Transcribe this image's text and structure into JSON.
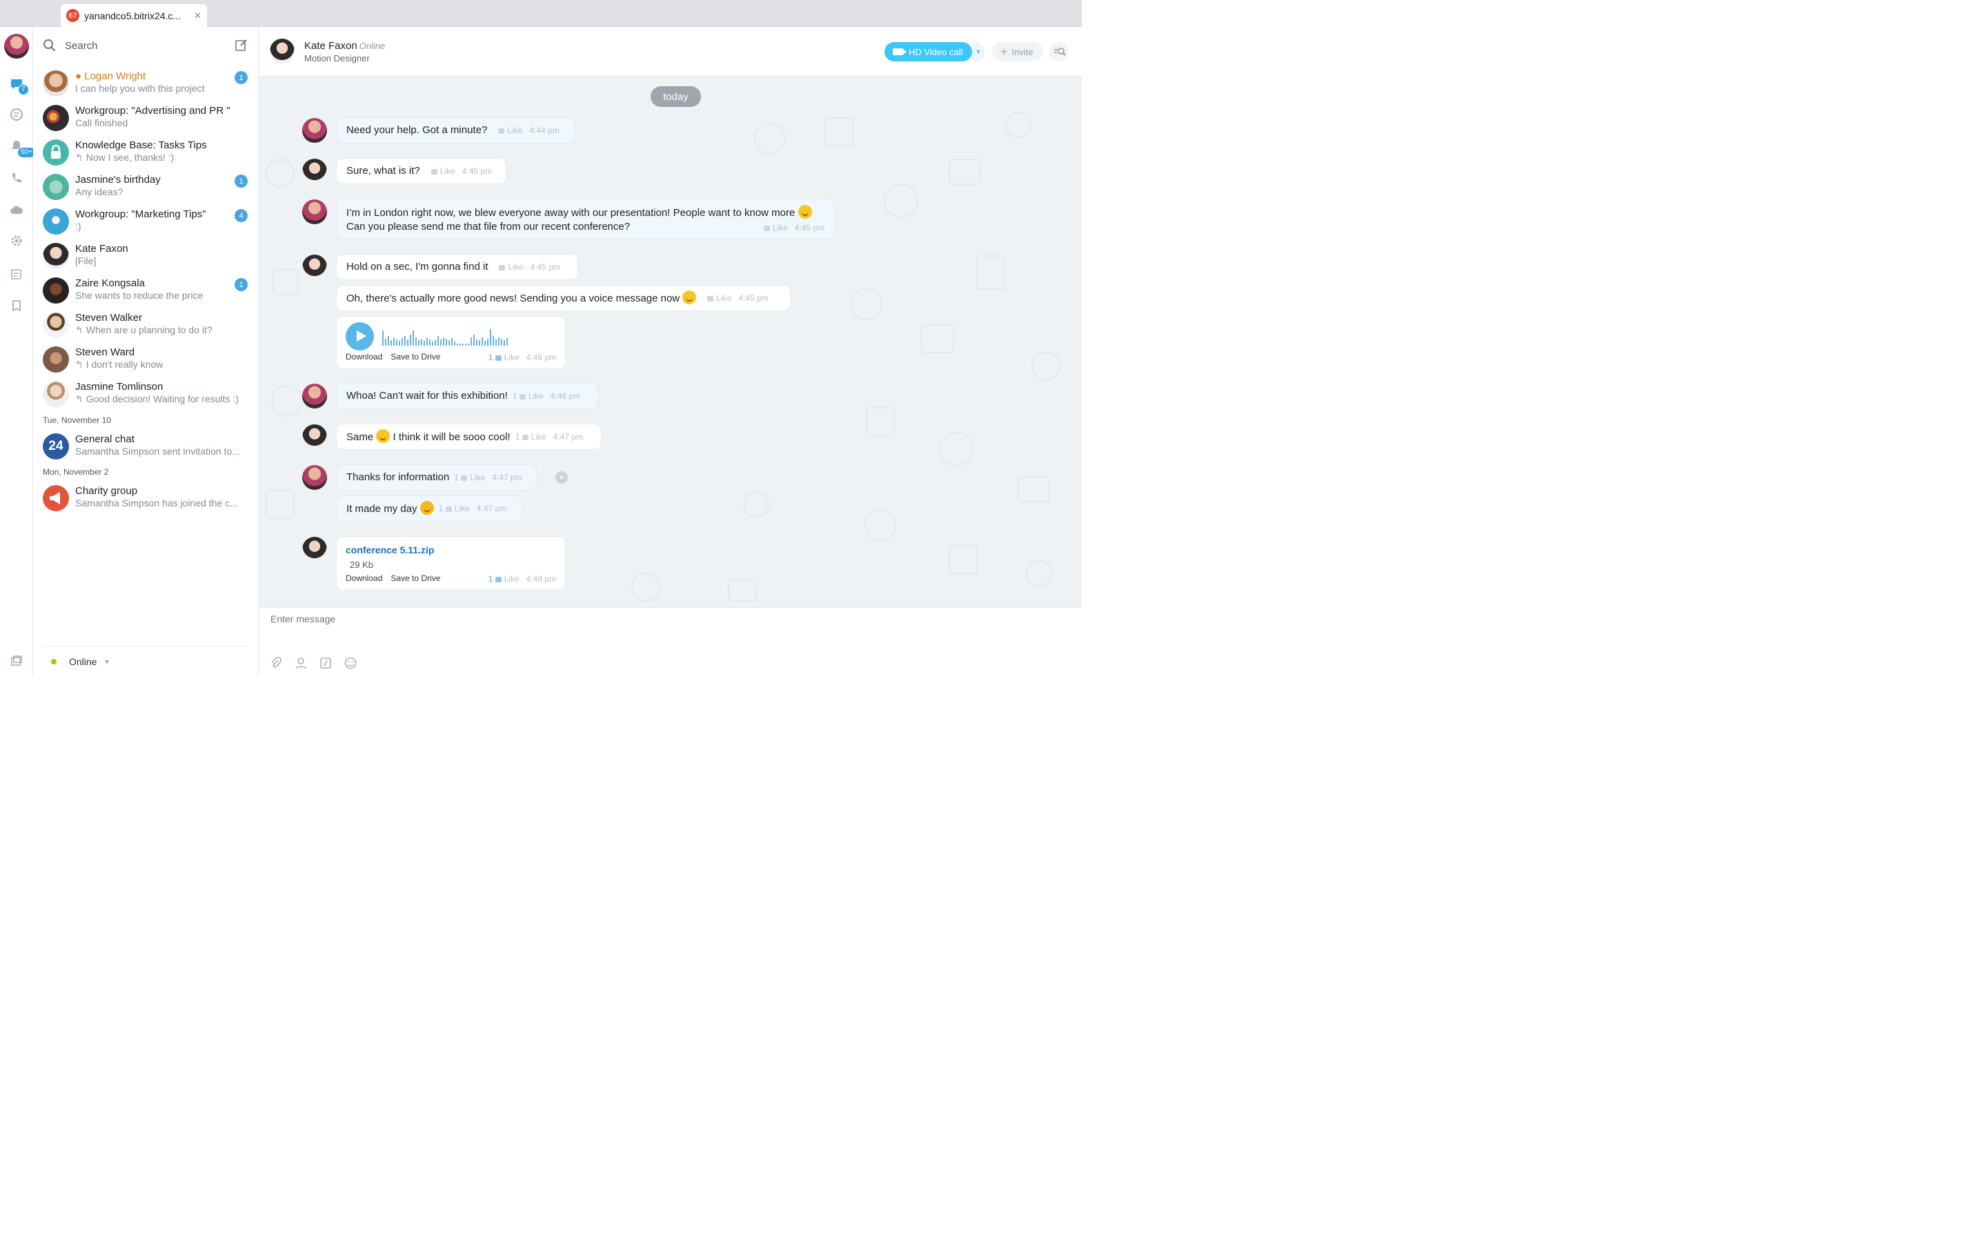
{
  "browser": {
    "tab_badge": "67",
    "tab_title": "yanandco5.bitrix24.c...",
    "tab_close": "✕"
  },
  "rail": {
    "chat_badge": "7",
    "notify_badge": "50+"
  },
  "sidebar": {
    "search_label": "Search",
    "items": [
      {
        "name": "Logan Wright",
        "sub": "I can help you with this project",
        "count": "1",
        "reply": false,
        "color": "#d67c1e"
      },
      {
        "name": "Workgroup: \"Advertising and PR \"",
        "sub": "Call finished",
        "count": "",
        "reply": false
      },
      {
        "name": "Knowledge Base: Tasks Tips",
        "sub": "Now I see, thanks! :)",
        "count": "",
        "reply": true
      },
      {
        "name": "Jasmine's birthday",
        "sub": "Any ideas?",
        "count": "1",
        "reply": false
      },
      {
        "name": "Workgroup: \"Marketing Tips\"",
        "sub": ":)",
        "count": "4",
        "reply": false
      },
      {
        "name": "Kate Faxon",
        "sub": "[File]",
        "count": "",
        "reply": false
      },
      {
        "name": "Zaire Kongsala",
        "sub": "She wants to reduce the price",
        "count": "1",
        "reply": false
      },
      {
        "name": "Steven Walker",
        "sub": "When are u planning to do it?",
        "count": "",
        "reply": true
      },
      {
        "name": "Steven Ward",
        "sub": "I don't really know",
        "count": "",
        "reply": true
      },
      {
        "name": "Jasmine Tomlinson",
        "sub": "Good decision! Waiting for results :)",
        "count": "",
        "reply": true
      }
    ],
    "date_1": "Tue, November 10",
    "general": {
      "name": "General chat",
      "sub": "Samantha Simpson sent invitation to...",
      "icon_text": "24"
    },
    "date_2": "Mon, November 2",
    "charity": {
      "name": "Charity group",
      "sub": "Samantha Simpson has joined the c..."
    },
    "status": "Online"
  },
  "header": {
    "name": "Kate Faxon",
    "status": "Online",
    "role": "Motion Designer",
    "video_label": "HD Video call",
    "invite_label": "Invite"
  },
  "messages": {
    "day_label": "today",
    "like": "Like",
    "m1": {
      "text": "Need your help. Got a minute?",
      "time": "4:44 pm"
    },
    "m2": {
      "text": "Sure, what is it?",
      "time": "4:45 pm"
    },
    "m3": {
      "line1": "I’m in London right now, we blew everyone away with our presentation! People want to know more",
      "line2": "Can you please send me that file from our recent conference?",
      "time": "4:45 pm"
    },
    "m4": {
      "text": "Hold on a sec, I'm gonna find it",
      "time": "4:45 pm"
    },
    "m5": {
      "text": "Oh, there's actually more good news! Sending you a voice message now",
      "time": "4:45 pm"
    },
    "voice": {
      "download": "Download",
      "save": "Save to Drive",
      "likes": "1",
      "time": "4:46 pm"
    },
    "m6": {
      "text": "Whoa! Can't wait for this exhibition!",
      "likes": "1",
      "time": "4:46 pm"
    },
    "m7": {
      "before": "Same",
      "after": "I think it will be sooo cool!",
      "likes": "1",
      "time": "4:47 pm"
    },
    "m8": {
      "text": "Thanks for information",
      "likes": "1",
      "time": "4:47 pm"
    },
    "m9": {
      "text": "It made my day",
      "likes": "1",
      "time": "4:47 pm"
    },
    "file": {
      "name": "conference 5.11.zip",
      "size": "29 Kb",
      "download": "Download",
      "save": "Save to Drive",
      "likes": "1",
      "time": "4:48 pm"
    }
  },
  "composer": {
    "placeholder": "Enter message"
  }
}
